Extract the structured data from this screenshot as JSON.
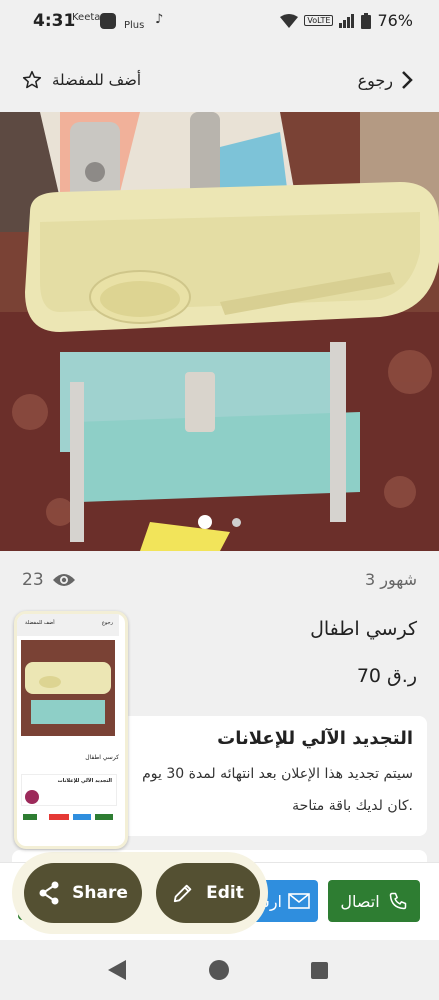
{
  "status_bar": {
    "time": "4:31",
    "app1": "Keeta",
    "app2": "Plus",
    "volte": "VoLTE",
    "battery": "76%"
  },
  "header": {
    "back_label": "رجوع",
    "favorite_label": "أضف للمفضلة"
  },
  "gallery": {
    "image_count": 2,
    "current_index": 1
  },
  "listing": {
    "views": "23",
    "posted": "3 شهور",
    "title": "كرسي اطفال",
    "price": "70 ر.ق"
  },
  "auto_renew": {
    "title": "التجديد الآلي للإعلانات",
    "line1": "سيتم تجديد هذا الإعلان بعد انتهائه لمدة 30 يوم",
    "line2": "كان لديك باقة متاحة."
  },
  "actions": {
    "call_label": "اتصال",
    "message_label": "ارسال",
    "share_label": "Share",
    "edit_label": "Edit"
  },
  "thumbnail": {
    "back": "رجوع",
    "fav": "أضف للمفضلة",
    "title": "كرسي اطفال",
    "renew_title": "التجديد الآلي للإعلانات"
  },
  "colors": {
    "call": "#2e7d32",
    "message": "#2f8ede",
    "fab": "#545032"
  }
}
